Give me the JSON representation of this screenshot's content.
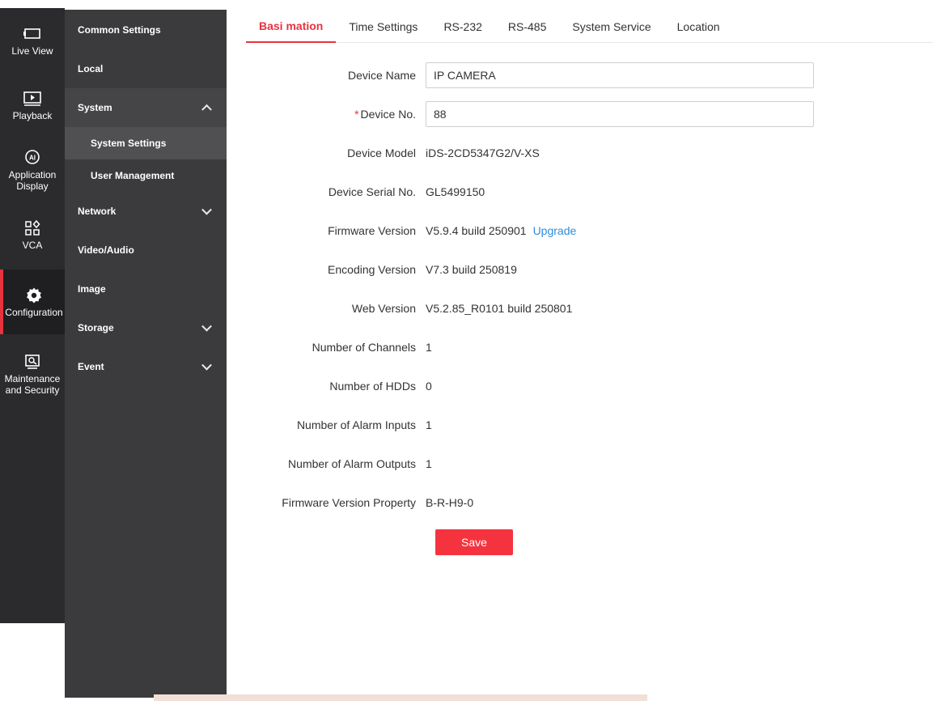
{
  "rail": {
    "items": [
      {
        "label": "Live View",
        "icon": "live-view-icon"
      },
      {
        "label": "Playback",
        "icon": "playback-icon"
      },
      {
        "label": "Application\nDisplay",
        "icon": "ai-icon"
      },
      {
        "label": "VCA",
        "icon": "vca-icon"
      },
      {
        "label": "Configuration",
        "icon": "gear-icon"
      },
      {
        "label": "Maintenance\nand Security",
        "icon": "maintenance-icon"
      }
    ],
    "active_index": 4
  },
  "submenu": {
    "common_settings": "Common Settings",
    "local": "Local",
    "system": "System",
    "system_settings": "System Settings",
    "user_management": "User Management",
    "network": "Network",
    "video_audio": "Video/Audio",
    "image": "Image",
    "storage": "Storage",
    "event": "Event"
  },
  "tabs": {
    "basic_information": "Basi  mation",
    "time_settings": "Time Settings",
    "rs232": "RS-232",
    "rs485": "RS-485",
    "system_service": "System Service",
    "location": "Location"
  },
  "form": {
    "device_name_label": "Device Name",
    "device_name_value": "IP CAMERA",
    "device_no_required": "*",
    "device_no_label": "Device No.",
    "device_no_value": "88",
    "device_model_label": "Device Model",
    "device_model_value": "iDS-2CD5347G2/V-XS",
    "serial_label": "Device Serial No.",
    "serial_value": "GL5499150",
    "firmware_label": "Firmware Version",
    "firmware_value": "V5.9.4 build 250901",
    "upgrade_link": "Upgrade",
    "encoding_label": "Encoding Version",
    "encoding_value": "V7.3 build 250819",
    "web_label": "Web Version",
    "web_value": "V5.2.85_R0101 build 250801",
    "channels_label": "Number of Channels",
    "channels_value": "1",
    "hdds_label": "Number of HDDs",
    "hdds_value": "0",
    "alarm_inputs_label": "Number of Alarm Inputs",
    "alarm_inputs_value": "1",
    "alarm_outputs_label": "Number of Alarm Outputs",
    "alarm_outputs_value": "1",
    "fw_property_label": "Firmware Version Property",
    "fw_property_value": "B-R-H9-0",
    "save_label": "Save"
  },
  "colors": {
    "accent": "#e8333f",
    "link": "#2e8bd8",
    "rail_bg": "#2b2b2e",
    "submenu_bg": "#3b3b3d"
  }
}
